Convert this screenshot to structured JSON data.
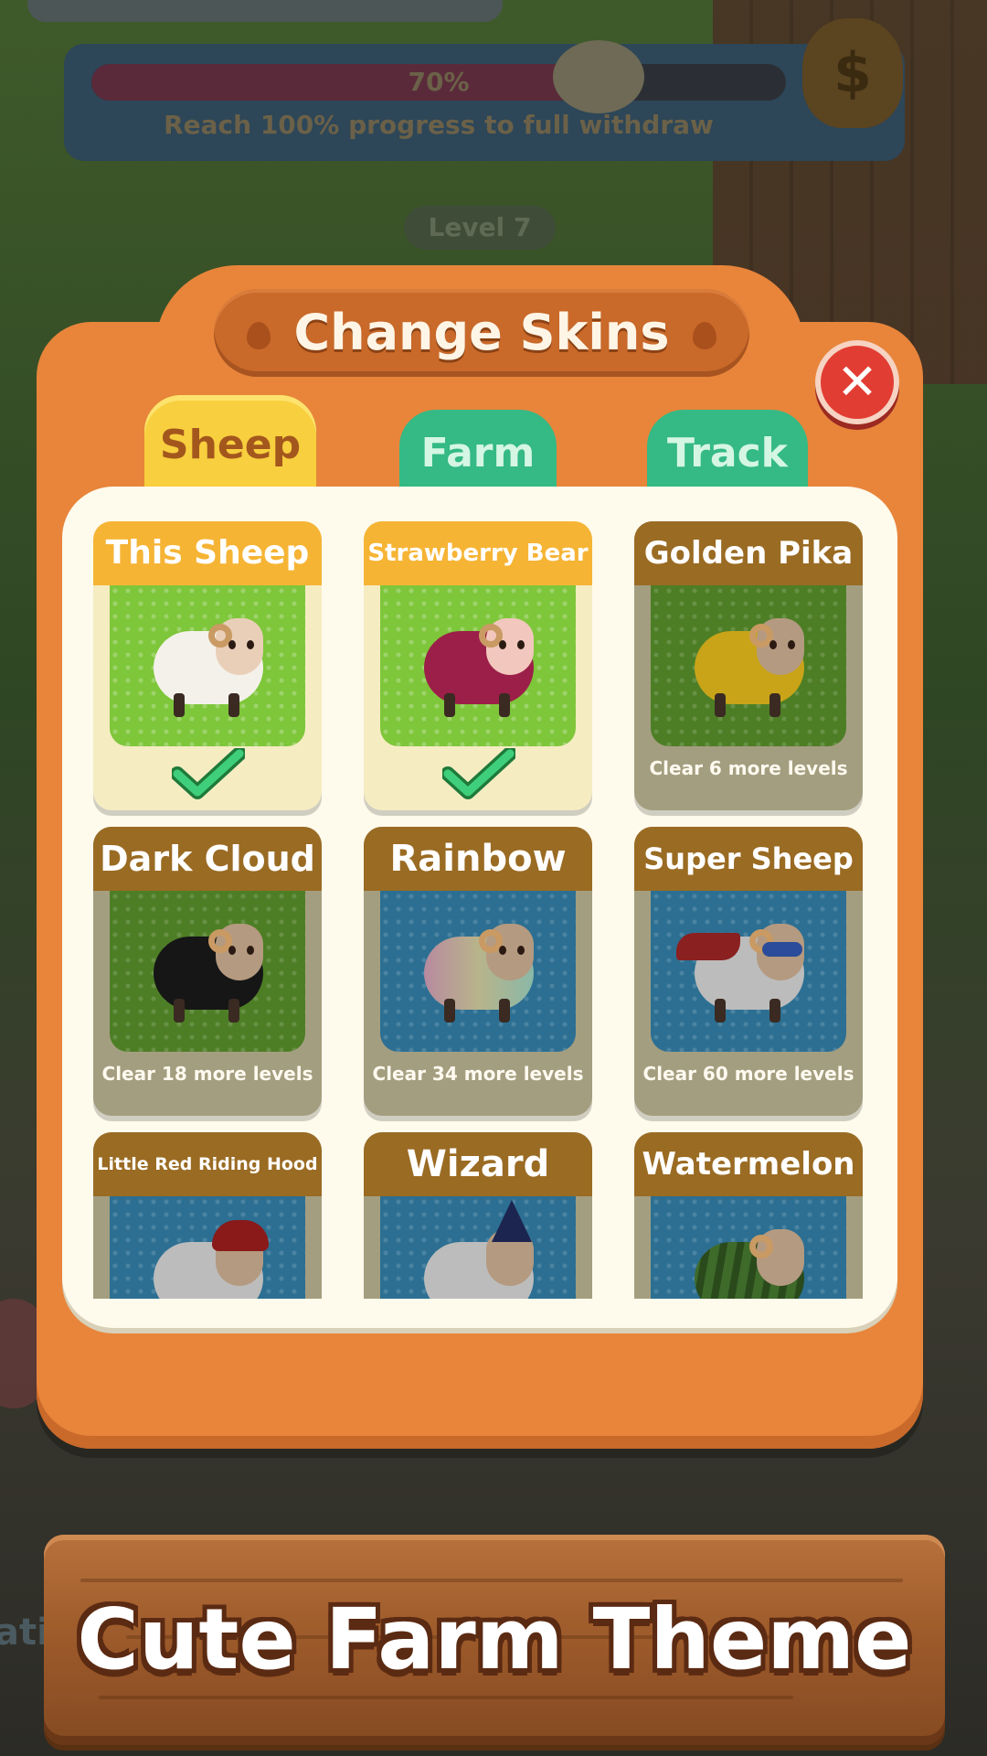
{
  "background": {
    "progress_percent": 70,
    "progress_label": "70%",
    "progress_message": "Reach 100% progress to full withdraw",
    "level_label": "Level 7",
    "side_text": "ati"
  },
  "modal": {
    "title": "Change Skins",
    "close_icon": "close-x-icon",
    "tabs": [
      {
        "label": "Sheep",
        "selected": true
      },
      {
        "label": "Farm",
        "selected": false
      },
      {
        "label": "Track",
        "selected": false
      }
    ],
    "skins": [
      {
        "name": "This Sheep",
        "status": "owned",
        "footer": "",
        "wool": "#f4f1ea"
      },
      {
        "name": "Strawberry Bear",
        "status": "owned",
        "footer": "",
        "wool": "#9b1f48"
      },
      {
        "name": "Golden Pika",
        "status": "locked",
        "footer": "Clear 6 more levels",
        "wool": "#c9a418"
      },
      {
        "name": "Dark Cloud",
        "status": "locked",
        "footer": "Clear 18 more levels",
        "wool": "#161616"
      },
      {
        "name": "Rainbow",
        "status": "locked",
        "footer": "Clear 34 more levels",
        "wool": "#b8b48a"
      },
      {
        "name": "Super Sheep",
        "status": "locked",
        "footer": "Clear 60 more levels",
        "wool": "#bcbcbc"
      },
      {
        "name": "Little Red Riding Hood",
        "status": "locked",
        "footer": "",
        "wool": "#bcbcbc"
      },
      {
        "name": "Wizard",
        "status": "locked",
        "footer": "",
        "wool": "#bcbcbc"
      },
      {
        "name": "Watermelon",
        "status": "locked",
        "footer": "",
        "wool": "#3e6a2a"
      }
    ]
  },
  "banner": {
    "text": "Cute Farm Theme"
  }
}
